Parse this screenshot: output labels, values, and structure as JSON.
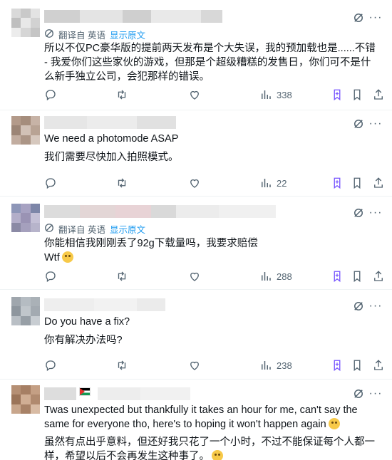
{
  "translate": {
    "label": "翻译自 英语",
    "show_original": "显示原文"
  },
  "posts": [
    {
      "text": "所以不仅PC豪华版的提前两天发布是个大失误，我的预加载也是......不错 - 我爱你们这些家伙的游戏，但那是个超级糟糕的发售日，你们可不是什么新手独立公司，会犯那样的错误。",
      "views": "338"
    },
    {
      "text_en": "We need a photomode ASAP",
      "text_zh": "我们需要尽快加入拍照模式。",
      "views": "22"
    },
    {
      "text": "你能相信我刚刚丢了92g下载量吗，我要求赔偿",
      "text2": "Wtf",
      "views": "288"
    },
    {
      "text_en": "Do you have a fix?",
      "text_zh": "你有解决办法吗?",
      "views": "238"
    },
    {
      "text_en": "Twas unexpected but thankfully it takes an hour for me, can't say the same for everyone tho, here's to hoping it won't happen again",
      "text_zh": "虽然有点出乎意料，但还好我只花了一个小时，不过不能保证每个人都一样，希望以后不会再发生这种事了。"
    }
  ],
  "icons": {
    "reply": "reply-icon",
    "retweet": "retweet-icon",
    "like": "like-icon",
    "views": "views-icon",
    "grok": "grok-icon",
    "bookmark": "bookmark-icon",
    "share": "share-icon",
    "more": "more-icon"
  },
  "colors": {
    "accent": "#1d9bf0",
    "muted": "#536471",
    "grok": "#7856ff"
  }
}
